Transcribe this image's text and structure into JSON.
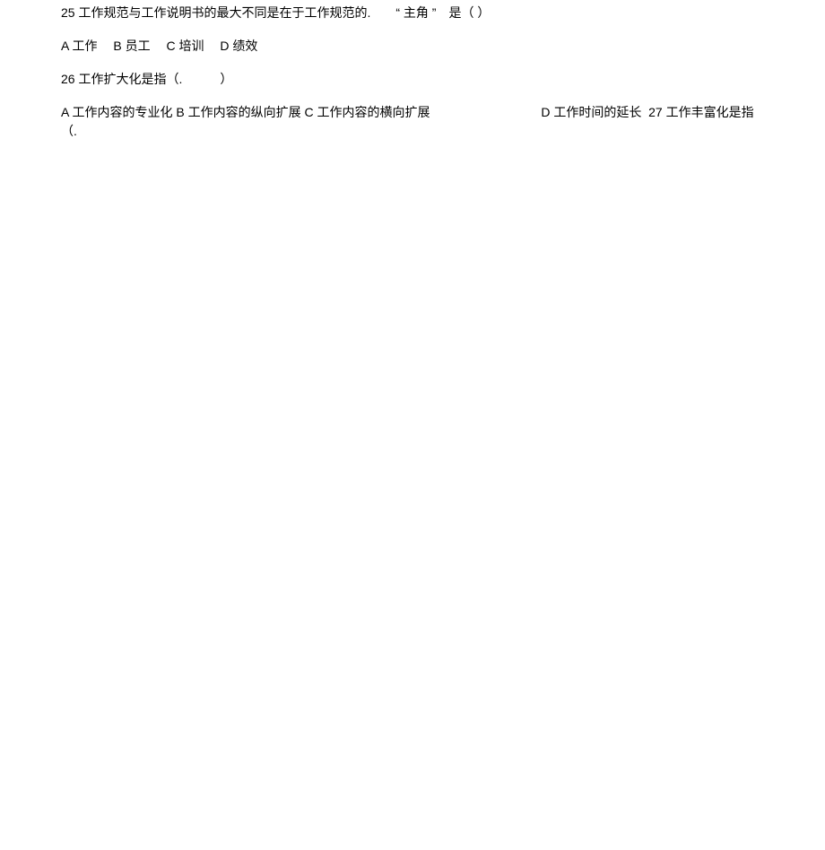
{
  "q25": {
    "stem": "25 工作规范与工作说明书的最大不同是在于工作规范的.　　“  主角  ”　是（  ）",
    "opts": {
      "a": "A 工作",
      "b": "B 员工",
      "c": "C 培训",
      "d": "D 绩效"
    }
  },
  "q26": {
    "stem": "26 工作扩大化是指（.　　　）",
    "line": "A 工作内容的专业化  B 工作内容的纵向扩展  C 工作内容的横向扩展",
    "d": "D 工作时间的延长",
    "q27_inline": "27 工作丰富化是指（."
  }
}
